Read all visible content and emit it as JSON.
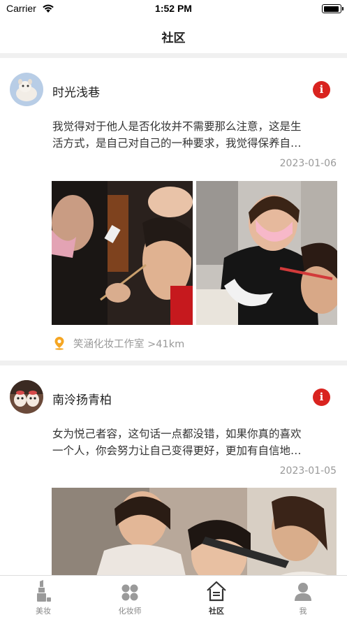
{
  "status_bar": {
    "carrier": "Carrier",
    "time": "1:52 PM"
  },
  "nav": {
    "title": "社区"
  },
  "posts": [
    {
      "username": "时光浅巷",
      "text_line1": "我觉得对于他人是否化妆并不需要那么注意，这是生",
      "text_line2": "活方式，是自己对自己的一种要求，我觉得保养自…",
      "date": "2023-01-06",
      "location": "笑涵化妆工作室 >41km"
    },
    {
      "username": "南泠扬青柏",
      "text_line1": "女为悦己者容，这句话一点都没错，如果你真的喜欢",
      "text_line2": "一个人，你会努力让自己变得更好，更加有自信地…",
      "date": "2023-01-05"
    }
  ],
  "tabs": [
    {
      "label": "美妆",
      "icon": "lipstick-icon",
      "active": false
    },
    {
      "label": "化妆师",
      "icon": "grid-icon",
      "active": false
    },
    {
      "label": "社区",
      "icon": "home-icon",
      "active": true
    },
    {
      "label": "我",
      "icon": "person-icon",
      "active": false
    }
  ],
  "colors": {
    "accent": "#d9231f",
    "pin": "#f5a623",
    "muted": "#999999"
  }
}
